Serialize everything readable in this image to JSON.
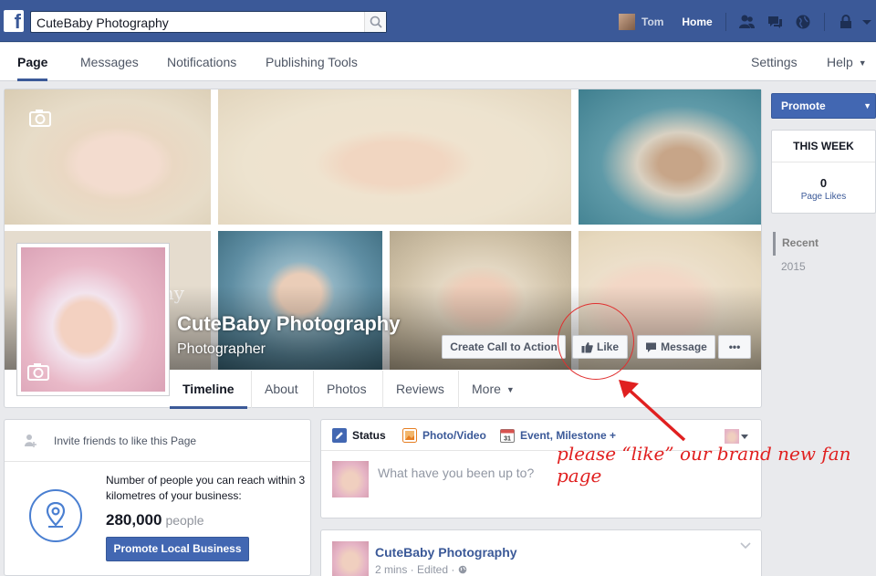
{
  "topbar": {
    "search_value": "CuteBaby Photography",
    "user_name": "Tom",
    "home_label": "Home",
    "icons": [
      "friends-icon",
      "messages-icon",
      "globe-icon",
      "privacy-lock-icon",
      "settings-caret-icon"
    ]
  },
  "pagenav": {
    "items": [
      "Page",
      "Messages",
      "Notifications",
      "Publishing Tools"
    ],
    "settings": "Settings",
    "help": "Help"
  },
  "cover": {
    "overlay_script": "phy",
    "page_name": "CuteBaby Photography",
    "category": "Photographer",
    "buttons": {
      "cta": "Create Call to Action",
      "like": "Like",
      "message": "Message",
      "more": "•••"
    },
    "tabs": [
      "Timeline",
      "About",
      "Photos",
      "Reviews",
      "More"
    ]
  },
  "right": {
    "promote": "Promote",
    "week_title": "THIS WEEK",
    "page_likes_count": "0",
    "page_likes_label": "Page Likes",
    "years": [
      "Recent",
      "2015"
    ]
  },
  "sidecard": {
    "invite": "Invite friends to like this Page",
    "reach_text": "Number of people you can reach within 3 kilometres of your business:",
    "reach_number": "280,000",
    "reach_unit": "people",
    "promote_local": "Promote Local Business"
  },
  "composer": {
    "tabs": [
      "Status",
      "Photo/Video",
      "Event, Milestone +"
    ],
    "placeholder": "What have you been up to?"
  },
  "post": {
    "author": "CuteBaby Photography",
    "meta": "2 mins · Edited · "
  },
  "annotation": {
    "text": "please “like” our brand new fan page",
    "color": "#e02020"
  },
  "colors": {
    "brand_blue": "#3b5998",
    "button_blue": "#4267b2"
  }
}
